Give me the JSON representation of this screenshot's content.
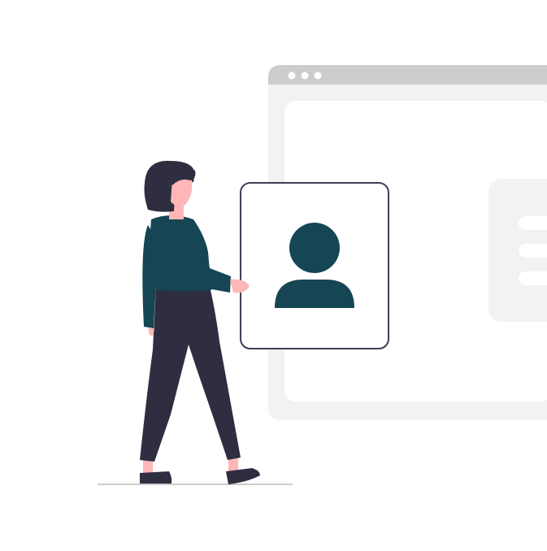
{
  "colors": {
    "window_frame": "#f2f2f2",
    "window_titlebar": "#cccccc",
    "window_dot": "#ffffff",
    "card_panel": "#f2f2f2",
    "card_line": "#ffffff",
    "profile_card_border": "#3f3d56",
    "profile_card_fill": "#ffffff",
    "avatar_fill": "#164553",
    "hair": "#2f2e41",
    "skin": "#ffb6b6",
    "shirt": "#164553",
    "pants": "#2f2e41",
    "shoes": "#2f2e41",
    "ground_line": "#cccccc"
  },
  "icons": {
    "window": "browser-window-icon",
    "avatar": "user-profile-icon",
    "person": "woman-figure-icon"
  }
}
